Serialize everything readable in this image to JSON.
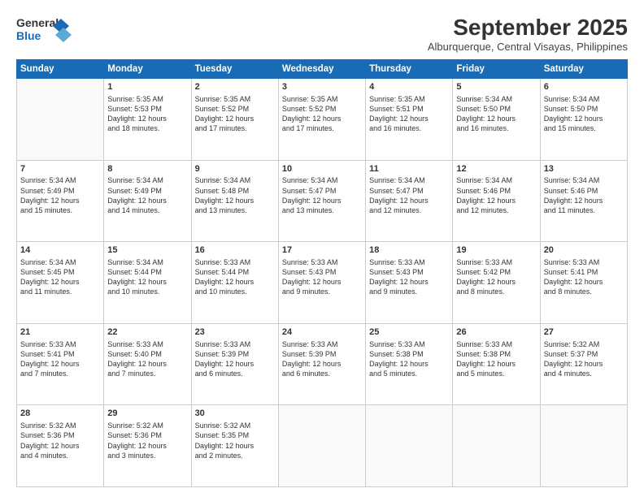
{
  "logo": {
    "line1": "General",
    "line2": "Blue"
  },
  "title": "September 2025",
  "location": "Alburquerque, Central Visayas, Philippines",
  "days_of_week": [
    "Sunday",
    "Monday",
    "Tuesday",
    "Wednesday",
    "Thursday",
    "Friday",
    "Saturday"
  ],
  "weeks": [
    [
      {
        "day": "",
        "content": ""
      },
      {
        "day": "1",
        "content": "Sunrise: 5:35 AM\nSunset: 5:53 PM\nDaylight: 12 hours\nand 18 minutes."
      },
      {
        "day": "2",
        "content": "Sunrise: 5:35 AM\nSunset: 5:52 PM\nDaylight: 12 hours\nand 17 minutes."
      },
      {
        "day": "3",
        "content": "Sunrise: 5:35 AM\nSunset: 5:52 PM\nDaylight: 12 hours\nand 17 minutes."
      },
      {
        "day": "4",
        "content": "Sunrise: 5:35 AM\nSunset: 5:51 PM\nDaylight: 12 hours\nand 16 minutes."
      },
      {
        "day": "5",
        "content": "Sunrise: 5:34 AM\nSunset: 5:50 PM\nDaylight: 12 hours\nand 16 minutes."
      },
      {
        "day": "6",
        "content": "Sunrise: 5:34 AM\nSunset: 5:50 PM\nDaylight: 12 hours\nand 15 minutes."
      }
    ],
    [
      {
        "day": "7",
        "content": "Sunrise: 5:34 AM\nSunset: 5:49 PM\nDaylight: 12 hours\nand 15 minutes."
      },
      {
        "day": "8",
        "content": "Sunrise: 5:34 AM\nSunset: 5:49 PM\nDaylight: 12 hours\nand 14 minutes."
      },
      {
        "day": "9",
        "content": "Sunrise: 5:34 AM\nSunset: 5:48 PM\nDaylight: 12 hours\nand 13 minutes."
      },
      {
        "day": "10",
        "content": "Sunrise: 5:34 AM\nSunset: 5:47 PM\nDaylight: 12 hours\nand 13 minutes."
      },
      {
        "day": "11",
        "content": "Sunrise: 5:34 AM\nSunset: 5:47 PM\nDaylight: 12 hours\nand 12 minutes."
      },
      {
        "day": "12",
        "content": "Sunrise: 5:34 AM\nSunset: 5:46 PM\nDaylight: 12 hours\nand 12 minutes."
      },
      {
        "day": "13",
        "content": "Sunrise: 5:34 AM\nSunset: 5:46 PM\nDaylight: 12 hours\nand 11 minutes."
      }
    ],
    [
      {
        "day": "14",
        "content": "Sunrise: 5:34 AM\nSunset: 5:45 PM\nDaylight: 12 hours\nand 11 minutes."
      },
      {
        "day": "15",
        "content": "Sunrise: 5:34 AM\nSunset: 5:44 PM\nDaylight: 12 hours\nand 10 minutes."
      },
      {
        "day": "16",
        "content": "Sunrise: 5:33 AM\nSunset: 5:44 PM\nDaylight: 12 hours\nand 10 minutes."
      },
      {
        "day": "17",
        "content": "Sunrise: 5:33 AM\nSunset: 5:43 PM\nDaylight: 12 hours\nand 9 minutes."
      },
      {
        "day": "18",
        "content": "Sunrise: 5:33 AM\nSunset: 5:43 PM\nDaylight: 12 hours\nand 9 minutes."
      },
      {
        "day": "19",
        "content": "Sunrise: 5:33 AM\nSunset: 5:42 PM\nDaylight: 12 hours\nand 8 minutes."
      },
      {
        "day": "20",
        "content": "Sunrise: 5:33 AM\nSunset: 5:41 PM\nDaylight: 12 hours\nand 8 minutes."
      }
    ],
    [
      {
        "day": "21",
        "content": "Sunrise: 5:33 AM\nSunset: 5:41 PM\nDaylight: 12 hours\nand 7 minutes."
      },
      {
        "day": "22",
        "content": "Sunrise: 5:33 AM\nSunset: 5:40 PM\nDaylight: 12 hours\nand 7 minutes."
      },
      {
        "day": "23",
        "content": "Sunrise: 5:33 AM\nSunset: 5:39 PM\nDaylight: 12 hours\nand 6 minutes."
      },
      {
        "day": "24",
        "content": "Sunrise: 5:33 AM\nSunset: 5:39 PM\nDaylight: 12 hours\nand 6 minutes."
      },
      {
        "day": "25",
        "content": "Sunrise: 5:33 AM\nSunset: 5:38 PM\nDaylight: 12 hours\nand 5 minutes."
      },
      {
        "day": "26",
        "content": "Sunrise: 5:33 AM\nSunset: 5:38 PM\nDaylight: 12 hours\nand 5 minutes."
      },
      {
        "day": "27",
        "content": "Sunrise: 5:32 AM\nSunset: 5:37 PM\nDaylight: 12 hours\nand 4 minutes."
      }
    ],
    [
      {
        "day": "28",
        "content": "Sunrise: 5:32 AM\nSunset: 5:36 PM\nDaylight: 12 hours\nand 4 minutes."
      },
      {
        "day": "29",
        "content": "Sunrise: 5:32 AM\nSunset: 5:36 PM\nDaylight: 12 hours\nand 3 minutes."
      },
      {
        "day": "30",
        "content": "Sunrise: 5:32 AM\nSunset: 5:35 PM\nDaylight: 12 hours\nand 2 minutes."
      },
      {
        "day": "",
        "content": ""
      },
      {
        "day": "",
        "content": ""
      },
      {
        "day": "",
        "content": ""
      },
      {
        "day": "",
        "content": ""
      }
    ]
  ]
}
